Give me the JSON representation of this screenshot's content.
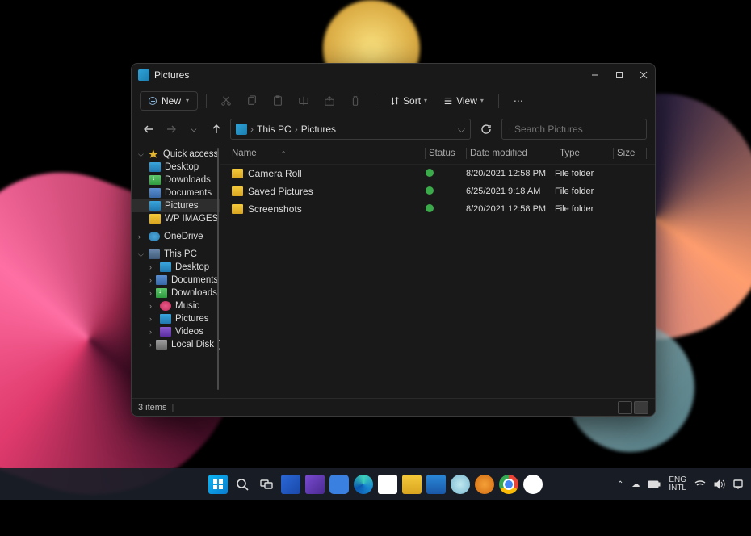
{
  "window": {
    "title": "Pictures",
    "minimize_tip": "Minimize",
    "maximize_tip": "Maximize",
    "close_tip": "Close"
  },
  "toolbar": {
    "new_label": "New",
    "sort_label": "Sort",
    "view_label": "View"
  },
  "breadcrumb": {
    "items": [
      "This PC",
      "Pictures"
    ]
  },
  "search": {
    "placeholder": "Search Pictures"
  },
  "sidebar": {
    "quick_access": "Quick access",
    "desktop": "Desktop",
    "downloads": "Downloads",
    "documents": "Documents",
    "pictures": "Pictures",
    "wp_images": "WP IMAGES",
    "onedrive": "OneDrive",
    "this_pc": "This PC",
    "pc_desktop": "Desktop",
    "pc_documents": "Documents",
    "pc_downloads": "Downloads",
    "pc_music": "Music",
    "pc_pictures": "Pictures",
    "pc_videos": "Videos",
    "pc_localdisk": "Local Disk (C:)"
  },
  "columns": {
    "name": "Name",
    "status": "Status",
    "date": "Date modified",
    "type": "Type",
    "size": "Size"
  },
  "rows": [
    {
      "name": "Camera Roll",
      "date": "8/20/2021 12:58 PM",
      "type": "File folder"
    },
    {
      "name": "Saved Pictures",
      "date": "6/25/2021 9:18 AM",
      "type": "File folder"
    },
    {
      "name": "Screenshots",
      "date": "8/20/2021 12:58 PM",
      "type": "File folder"
    }
  ],
  "status": {
    "count": "3 items"
  },
  "tray": {
    "lang1": "ENG",
    "lang2": "INTL"
  }
}
